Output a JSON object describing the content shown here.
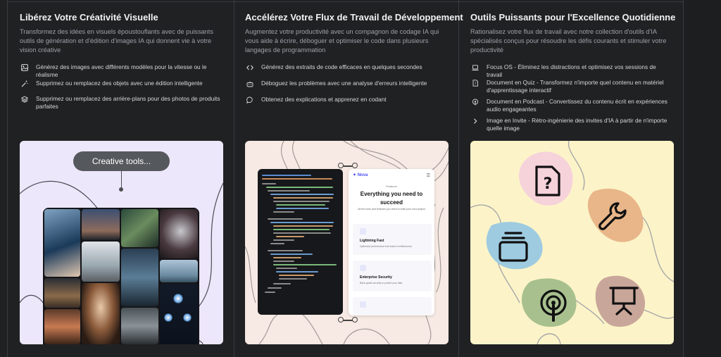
{
  "columns": [
    {
      "title": "Libérez Votre Créativité Visuelle",
      "description": "Transformez des idées en visuels époustouflants avec de puissants outils de génération et d'édition d'images IA qui donnent vie à votre vision créative",
      "features": [
        {
          "icon": "image-icon",
          "text": "Générez des images avec différents modèles pour la vitesse ou le réalisme"
        },
        {
          "icon": "magic-wand-icon",
          "text": "Supprimez ou remplacez des objets avec une édition intelligente"
        },
        {
          "icon": "layers-icon",
          "text": "Supprimez ou remplacez des arrière-plans pour des photos de produits parfaites"
        }
      ],
      "visual": {
        "pill": "Creative tools..."
      }
    },
    {
      "title": "Accélérez Votre Flux de Travail de Développement",
      "description": "Augmentez votre productivité avec un compagnon de codage IA qui vous aide à écrire, déboguer et optimiser le code dans plusieurs langages de programmation",
      "features": [
        {
          "icon": "code-icon",
          "text": "Générez des extraits de code efficaces en quelques secondes"
        },
        {
          "icon": "bot-icon",
          "text": "Déboguez les problèmes avec une analyse d'erreurs intelligente"
        },
        {
          "icon": "chat-icon",
          "text": "Obtenez des explications et apprenez en codant"
        }
      ],
      "visual": {
        "brand": "Nova",
        "menu": "☰",
        "features_label": "Features",
        "headline": "Everything you need to succeed",
        "subline": "All the tools and features you need to build your next project",
        "cards": [
          {
            "title": "Lightning Fast",
            "desc": "Optimized performance that loads in milliseconds"
          },
          {
            "title": "Enterprise Security",
            "desc": "Bank-grade security to protect your data"
          },
          {
            "title": "",
            "desc": ""
          }
        ]
      }
    },
    {
      "title": "Outils Puissants pour l'Excellence Quotidienne",
      "description": "Rationalisez votre flux de travail avec notre collection d'outils d'IA spécialisés conçus pour résoudre les défis courants et stimuler votre productivité",
      "features": [
        {
          "icon": "laptop-icon",
          "text": "Focus OS - Éliminez les distractions et optimisez vos sessions de travail"
        },
        {
          "icon": "quiz-file-icon",
          "text": "Document en Quiz - Transformez n'importe quel contenu en matériel d'apprentissage interactif"
        },
        {
          "icon": "podcast-icon",
          "text": "Document en Podcast - Convertissez du contenu écrit en expériences audio engageantes"
        },
        {
          "icon": "chevron-right-icon",
          "text": "Image en Invite - Rétro-ingénierie des invites d'IA à partir de n'importe quelle image"
        }
      ]
    }
  ],
  "colors": {
    "background": "#202123",
    "card_purple": "#ede7fb",
    "card_peach": "#f7e9e3",
    "card_yellow": "#fcf4c8",
    "blob_pink": "#f6d2da",
    "blob_orange": "#e8b689",
    "blob_blue": "#9ecbe0",
    "blob_green": "#a8c08e",
    "blob_mauve": "#c9a69a"
  }
}
